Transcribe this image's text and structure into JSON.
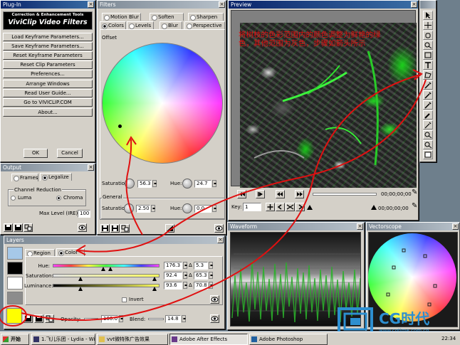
{
  "plugin": {
    "title": "Plug-In",
    "brand_sub": "Correction & Enhancement Tools",
    "brand": "ViviClip Video Filters",
    "menu": [
      "Load Keyframe Parameters...",
      "Save Keyframe Parameters...",
      "Reset Keyframe Parameters",
      "Reset Clip Parameters",
      "Preferences...",
      "Arrange Windows",
      "Read User Guide...",
      "Go to VIVICLIP.COM",
      "About..."
    ],
    "ok": "OK",
    "cancel": "Cancel"
  },
  "filters": {
    "title": "Filters",
    "tabs_row1": [
      "Motion Blur",
      "Soften",
      "Sharpen"
    ],
    "tabs_row2": [
      "Colors",
      "Levels",
      "Blur",
      "Perspective"
    ],
    "offset_label": "Offset",
    "saturation_label": "Saturation:",
    "saturation_value": "56.3",
    "hue_label": "Hue:",
    "hue_value": "24.7",
    "general_label": "General",
    "gen_saturation_label": "Saturation:",
    "gen_saturation_value": "2.50",
    "gen_hue_label": "Hue:",
    "gen_hue_value": "0.0"
  },
  "output": {
    "title": "Output",
    "tabs": [
      "Frames",
      "Legalize"
    ],
    "channel_label": "Channel Reduction",
    "luma": "Luma",
    "chroma": "Chroma",
    "max_label": "Max Level (IRE):",
    "max_value": "100"
  },
  "preview": {
    "title": "Preview",
    "annotation": "将树枝的色彩范围内的颜色调整为鲜艳的绿色，其他范围为灰色，步骤如箭头所示",
    "timecode1": "00;00;00;00",
    "timecode2": "00;00;00;00",
    "key_label": "Key:",
    "key_value": "1"
  },
  "layers": {
    "title": "Layers",
    "region": "Region",
    "color": "Color",
    "hue_label": "Hue:",
    "hue_value": "176.3",
    "hue_delta": "5.3",
    "sat_label": "Saturation:",
    "sat_value": "92.4",
    "sat_delta": "65.3",
    "lum_label": "Luminance:",
    "lum_value": "93.6",
    "lum_delta": "70.8",
    "invert": "Invert",
    "opacity_label": "Opacity:",
    "opacity_value": "100.0",
    "blend_label": "Blend:",
    "blend_value": "14.8",
    "swatch_colors": [
      "#a6c8e8",
      "#000000",
      "#ffffff",
      "#8c8c8c",
      "#ffff00"
    ]
  },
  "waveform": {
    "title": "Waveform"
  },
  "vectorscope": {
    "title": "Vectorscope"
  },
  "taskbar": {
    "start": "开始",
    "items": [
      "1.飞儿乐团 - Lydia - Wi...",
      "vvt微特殊广告效果",
      "Adobe After Effects",
      "Adobe Photoshop"
    ],
    "time": "22:34"
  },
  "watermark": {
    "brand": "CG时代",
    "url": "www.cgtime.com.cn"
  },
  "colors": {
    "annotation_red": "#e01010",
    "selected_swatch": "#ffff00",
    "title_active": "#0a246a"
  }
}
